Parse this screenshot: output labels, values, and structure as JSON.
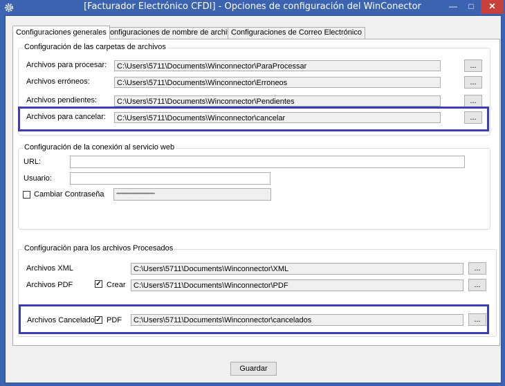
{
  "window": {
    "title": "[Facturador Electrónico CFDI] - Opciones de configuración del WinConector",
    "minimize_glyph": "—",
    "maximize_glyph": "□",
    "close_glyph": "✕",
    "app_icon": "gear-icon"
  },
  "tabs": [
    {
      "label": "Configuraciones generales",
      "active": true
    },
    {
      "label": "Configuraciones de nombre de archivos",
      "active": false
    },
    {
      "label": "Configuraciones de Correo Electrónico",
      "active": false
    }
  ],
  "folders": {
    "title": "Configuración de las carpetas de archivos",
    "rows": [
      {
        "label": "Archivos para procesar:",
        "value": "C:\\Users\\5711\\Documents\\Winconnector\\ParaProcessar",
        "button": "..."
      },
      {
        "label": "Archivos erróneos:",
        "value": "C:\\Users\\5711\\Documents\\Winconnector\\Erroneos",
        "button": "..."
      },
      {
        "label": "Archivos pendientes:",
        "value": "C:\\Users\\5711\\Documents\\Winconnector\\Pendientes",
        "button": "..."
      },
      {
        "label": "Archivos para cancelar:",
        "value": "C:\\Users\\5711\\Documents\\Winconnector\\cancelar",
        "button": "..."
      }
    ]
  },
  "webservice": {
    "title": "Configuración de la conexión al servicio web",
    "url_label": "URL:",
    "url_value": "",
    "user_label": "Usuario:",
    "user_value": "",
    "change_password_label": "Cambiar Contraseña",
    "change_password_checked": false,
    "password_mask": "••••••••••••••••••••••••••••••••••••••"
  },
  "processed": {
    "title": "Configuración para los archivos Procesados",
    "xml_label": "Archivos XML",
    "xml_value": "C:\\Users\\5711\\Documents\\Winconnector\\XML",
    "pdf_label": "Archivos PDF",
    "pdf_create_label": "Crear",
    "pdf_create_checked": true,
    "pdf_value": "C:\\Users\\5711\\Documents\\Winconnector\\PDF",
    "canceled_label": "Archivos Cancelados",
    "canceled_pdf_label": "PDF",
    "canceled_pdf_checked": true,
    "canceled_value": "C:\\Users\\5711\\Documents\\Winconnector\\cancelados",
    "button": "..."
  },
  "checkbox_mark": "✓",
  "save_button": "Guardar",
  "colors": {
    "titlebar": "#3b63b0",
    "close_button": "#c7413a",
    "highlight": "#3c3cb3"
  }
}
